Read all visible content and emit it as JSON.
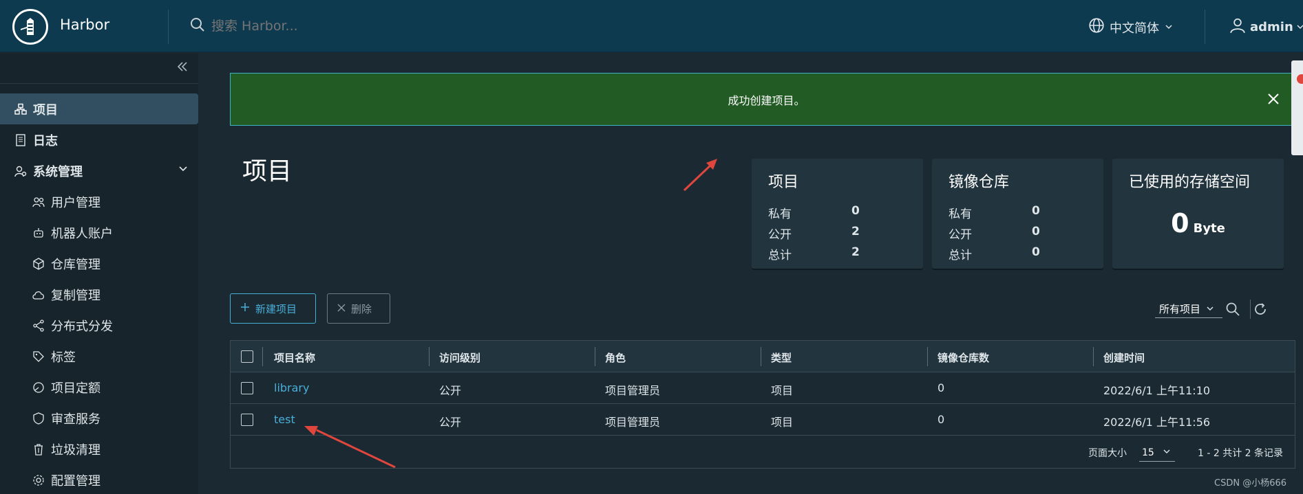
{
  "header": {
    "brand": "Harbor",
    "search_placeholder": "搜索 Harbor...",
    "language": "中文简体",
    "user": "admin"
  },
  "sidebar": {
    "items": [
      {
        "label": "项目",
        "icon": "projects-icon"
      },
      {
        "label": "日志",
        "icon": "log-icon"
      },
      {
        "label": "系统管理",
        "icon": "admin-icon"
      },
      {
        "label": "用户管理",
        "icon": "users-icon"
      },
      {
        "label": "机器人账户",
        "icon": "robot-icon"
      },
      {
        "label": "仓库管理",
        "icon": "registry-icon"
      },
      {
        "label": "复制管理",
        "icon": "replication-icon"
      },
      {
        "label": "分布式分发",
        "icon": "distribution-icon"
      },
      {
        "label": "标签",
        "icon": "tag-icon"
      },
      {
        "label": "项目定额",
        "icon": "quota-icon"
      },
      {
        "label": "审查服务",
        "icon": "shield-icon"
      },
      {
        "label": "垃圾清理",
        "icon": "trash-icon"
      },
      {
        "label": "配置管理",
        "icon": "gear-icon"
      }
    ]
  },
  "alert": {
    "message": "成功创建项目。"
  },
  "page": {
    "title": "项目"
  },
  "cards": {
    "projects": {
      "title": "项目",
      "private_label": "私有",
      "private": "0",
      "public_label": "公开",
      "public": "2",
      "total_label": "总计",
      "total": "2"
    },
    "repos": {
      "title": "镜像仓库",
      "private_label": "私有",
      "private": "0",
      "public_label": "公开",
      "public": "0",
      "total_label": "总计",
      "total": "0"
    },
    "storage": {
      "title": "已使用的存储空间",
      "value": "0",
      "unit": "Byte"
    }
  },
  "toolbar": {
    "new_label": "新建项目",
    "delete_label": "删除",
    "filter": "所有项目"
  },
  "table": {
    "headers": [
      "项目名称",
      "访问级别",
      "角色",
      "类型",
      "镜像仓库数",
      "创建时间"
    ],
    "rows": [
      [
        "library",
        "公开",
        "项目管理员",
        "项目",
        "0",
        "2022/6/1 上午11:10"
      ],
      [
        "test",
        "公开",
        "项目管理员",
        "项目",
        "0",
        "2022/6/1 上午11:56"
      ]
    ],
    "page_size_label": "页面大小",
    "page_size": "15",
    "page_info": "1 - 2 共计 2 条记录"
  },
  "watermark": "CSDN @小杨666",
  "colors": {
    "header_bg": "#0e3a4f",
    "sidebar_bg": "#17242b",
    "content_bg": "#1b2a32",
    "accent": "#49afd9",
    "success_bg": "#225b23",
    "annotation_arrow": "#e0463e"
  }
}
